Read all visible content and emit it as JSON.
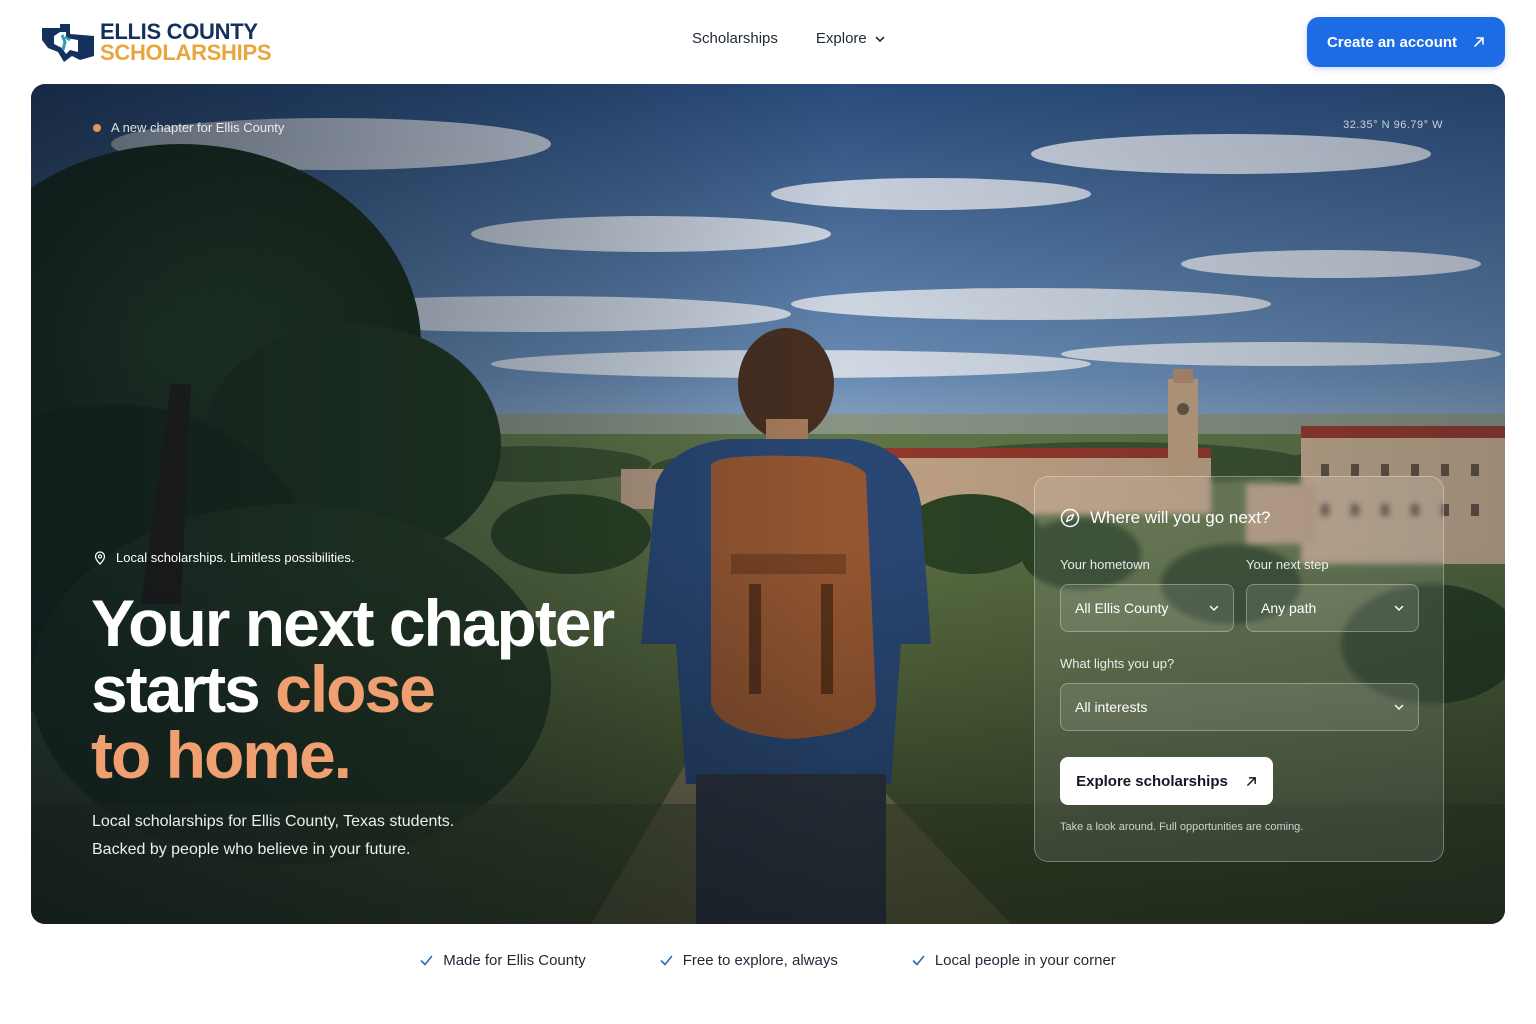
{
  "brand": {
    "name_line1": "ELLIS COUNTY",
    "name_line2": "SCHOLARSHIPS",
    "icon": "texas-state-logo-icon",
    "colors": {
      "navy": "#14305c",
      "gold": "#e8a73c",
      "teal": "#2f9fb5"
    }
  },
  "nav": {
    "items": [
      {
        "label": "Scholarships"
      },
      {
        "label": "Explore",
        "icon": "chevron-down-icon"
      }
    ]
  },
  "header_cta": {
    "label": "Create an account",
    "icon": "arrow-up-right-icon",
    "color": "#1e6be6"
  },
  "hero": {
    "eyebrow": "A new chapter for Ellis County",
    "coords": "32.35° N   96.79° W",
    "tagline": "Local scholarships. Limitless possibilities.",
    "headline": {
      "line1": "Your next chapter",
      "line2_plain": "starts ",
      "line2_accent": "close",
      "line3_accent": "to home."
    },
    "accent_color": "#f0a070",
    "subtext_line1": "Local scholarships for Ellis County, Texas students.",
    "subtext_line2": "Backed by people who believe in your future."
  },
  "search_panel": {
    "title": "Where will you go next?",
    "title_icon": "compass-icon",
    "hometown": {
      "label": "Your hometown",
      "value": "All Ellis County"
    },
    "next_step": {
      "label": "Your next step",
      "value": "Any path"
    },
    "interests": {
      "label": "What lights you up?",
      "value": "All interests"
    },
    "button_label": "Explore scholarships",
    "note": "Take a look around. Full opportunities are coming."
  },
  "features": [
    {
      "label": "Made for Ellis County",
      "icon": "check-icon"
    },
    {
      "label": "Free to explore, always",
      "icon": "check-icon"
    },
    {
      "label": "Local people in your corner",
      "icon": "check-icon"
    }
  ]
}
